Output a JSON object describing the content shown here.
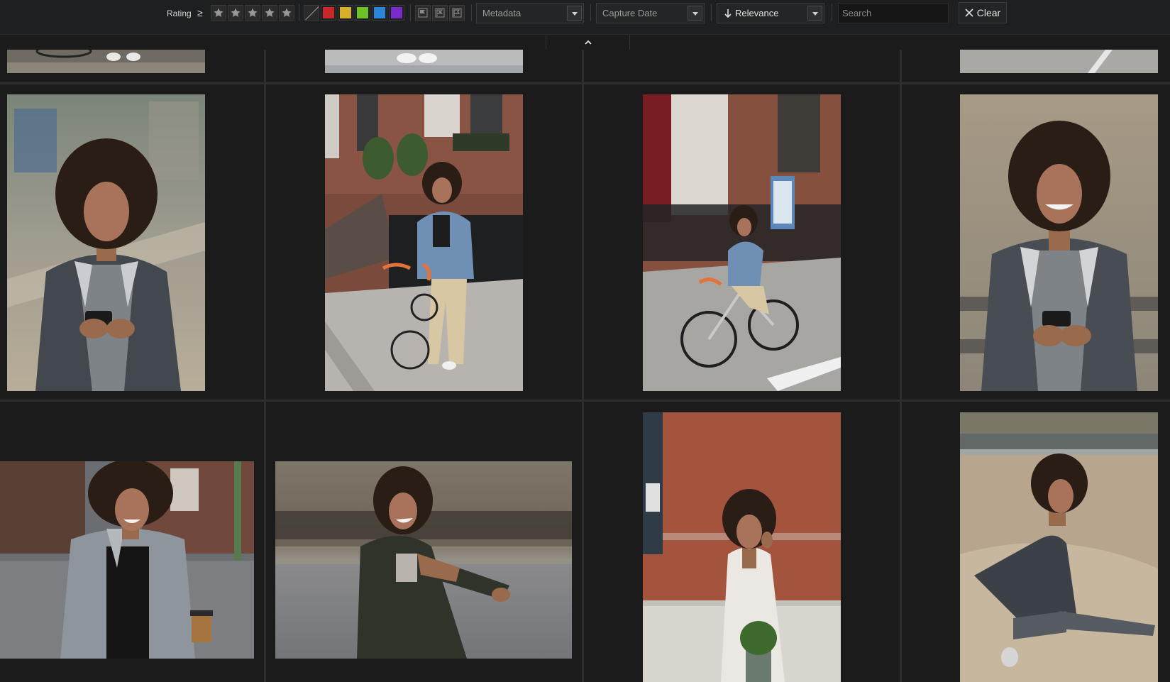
{
  "filter_bar": {
    "rating_label": "Rating",
    "rating_operator": "≥",
    "rating_stars": 5,
    "color_labels": [
      {
        "name": "none",
        "color": ""
      },
      {
        "name": "red",
        "color": "#c8282a"
      },
      {
        "name": "yellow",
        "color": "#d6b02a"
      },
      {
        "name": "green",
        "color": "#6fc226"
      },
      {
        "name": "blue",
        "color": "#2a86d6"
      },
      {
        "name": "purple",
        "color": "#7a2cc8"
      }
    ],
    "flag_filters": [
      "flagged-icon",
      "rejected-icon",
      "unflagged-icon"
    ],
    "metadata_dropdown": "Metadata",
    "capture_date_dropdown": "Capture Date",
    "sort_dropdown": "Relevance",
    "search_placeholder": "Search",
    "clear_label": "Clear"
  },
  "collapse_icon": "chevron-up-icon",
  "grid": {
    "columns": 4,
    "thumbnails": [
      {
        "row": 0,
        "col": 0,
        "subject": "partial-bicycle-photo"
      },
      {
        "row": 0,
        "col": 1,
        "subject": "partial-sneakers-photo"
      },
      {
        "row": 0,
        "col": 3,
        "subject": "partial-street-photo"
      },
      {
        "row": 1,
        "col": 0,
        "subject": "woman-texting-park"
      },
      {
        "row": 1,
        "col": 1,
        "subject": "woman-walking-bicycle-brownstone"
      },
      {
        "row": 1,
        "col": 2,
        "subject": "woman-riding-bicycle-street"
      },
      {
        "row": 1,
        "col": 3,
        "subject": "woman-smiling-phone-park"
      },
      {
        "row": 2,
        "col": 0,
        "subject": "woman-coffee-street"
      },
      {
        "row": 2,
        "col": 1,
        "subject": "woman-stretching-arms"
      },
      {
        "row": 2,
        "col": 2,
        "subject": "woman-phone-brick-wall"
      },
      {
        "row": 2,
        "col": 3,
        "subject": "woman-lunge-stretch"
      }
    ]
  },
  "colors": {
    "background": "#1b1b1b",
    "toolbar": "#1e1f20",
    "divider": "#2e2e2e"
  }
}
